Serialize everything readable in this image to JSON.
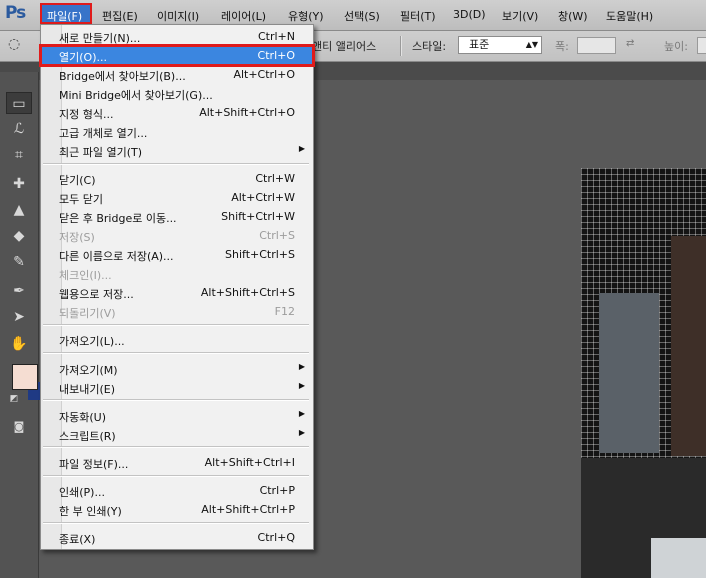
{
  "app": {
    "logo": "Ps"
  },
  "menubar": {
    "items": [
      "파일(F)",
      "편집(E)",
      "이미지(I)",
      "레이어(L)",
      "유형(Y)",
      "선택(S)",
      "필터(T)",
      "3D(D)",
      "보기(V)",
      "창(W)",
      "도움말(H)"
    ]
  },
  "options": {
    "anti_alias_partial": "앤티 앨리어스",
    "style_label": "스타일:",
    "style_value": "표준",
    "width_label": "폭:",
    "height_label": "높이:"
  },
  "file_menu": {
    "items": [
      {
        "label": "새로 만들기(N)...",
        "shortcut": "Ctrl+N"
      },
      {
        "label": "열기(O)...",
        "shortcut": "Ctrl+O"
      },
      {
        "label": "Bridge에서 찾아보기(B)...",
        "shortcut": "Alt+Ctrl+O"
      },
      {
        "label": "Mini Bridge에서 찾아보기(G)...",
        "shortcut": ""
      },
      {
        "label": "지정 형식...",
        "shortcut": "Alt+Shift+Ctrl+O"
      },
      {
        "label": "고급 개체로 열기...",
        "shortcut": ""
      },
      {
        "label": "최근 파일 열기(T)",
        "shortcut": ""
      },
      {
        "label": "닫기(C)",
        "shortcut": "Ctrl+W"
      },
      {
        "label": "모두 닫기",
        "shortcut": "Alt+Ctrl+W"
      },
      {
        "label": "닫은 후 Bridge로 이동...",
        "shortcut": "Shift+Ctrl+W"
      },
      {
        "label": "저장(S)",
        "shortcut": "Ctrl+S"
      },
      {
        "label": "다른 이름으로 저장(A)...",
        "shortcut": "Shift+Ctrl+S"
      },
      {
        "label": "체크인(I)...",
        "shortcut": ""
      },
      {
        "label": "웹용으로 저장...",
        "shortcut": "Alt+Shift+Ctrl+S"
      },
      {
        "label": "되돌리기(V)",
        "shortcut": "F12"
      },
      {
        "label": "가져오기(L)...",
        "shortcut": ""
      },
      {
        "label": "가져오기(M)",
        "shortcut": ""
      },
      {
        "label": "내보내기(E)",
        "shortcut": ""
      },
      {
        "label": "자동화(U)",
        "shortcut": ""
      },
      {
        "label": "스크립트(R)",
        "shortcut": ""
      },
      {
        "label": "파일 정보(F)...",
        "shortcut": "Alt+Shift+Ctrl+I"
      },
      {
        "label": "인쇄(P)...",
        "shortcut": "Ctrl+P"
      },
      {
        "label": "한 부 인쇄(Y)",
        "shortcut": "Alt+Shift+Ctrl+P"
      },
      {
        "label": "종료(X)",
        "shortcut": "Ctrl+Q"
      }
    ]
  },
  "colors": {
    "accent": "#3b86e0",
    "highlight_border": "#e01b1b",
    "foreground_swatch": "#f5ddd2",
    "background_swatch": "#1f3a84"
  },
  "tool_icons": [
    "marquee-icon",
    "lasso-icon",
    "crop-icon",
    "spot-heal-icon",
    "stamp-icon",
    "eraser-icon",
    "smudge-icon",
    "pen-icon",
    "select-arrow-icon",
    "hand-icon"
  ]
}
